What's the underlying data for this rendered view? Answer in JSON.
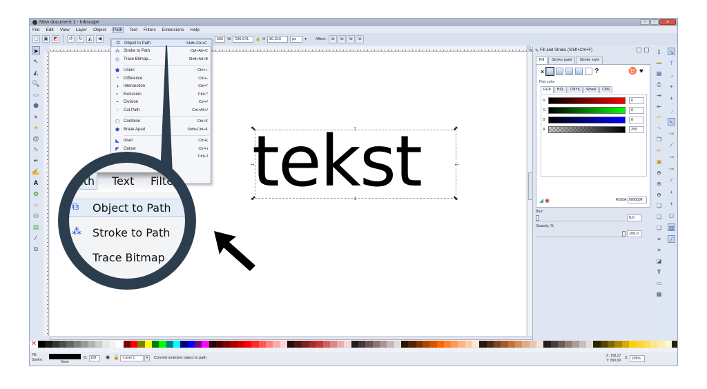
{
  "window": {
    "title": "New document 1 - Inkscape",
    "controls": {
      "minimize": "–",
      "maximize": "▫",
      "close": "x"
    }
  },
  "menubar": [
    "File",
    "Edit",
    "View",
    "Layer",
    "Object",
    "Path",
    "Text",
    "Filters",
    "Extensions",
    "Help"
  ],
  "menubar_active": "Path",
  "toolbar": {
    "x_value": "506",
    "w_label": "W",
    "w_value": "236,641",
    "h_label": "H",
    "h_value": "80,316",
    "unit": "px",
    "affect_label": "Affect:"
  },
  "path_menu": [
    {
      "icon": "object-to-path-icon",
      "label": "Object to Path",
      "shortcut": "Shift+Ctrl+C",
      "highlighted": true
    },
    {
      "icon": "stroke-to-path-icon",
      "label": "Stroke to Path",
      "shortcut": "Ctrl+Alt+C"
    },
    {
      "icon": "trace-bitmap-icon",
      "label": "Trace Bitmap...",
      "shortcut": "Shift+Alt+B"
    },
    {
      "separator": true
    },
    {
      "icon": "union-icon",
      "label": "Union",
      "shortcut": "Ctrl++"
    },
    {
      "icon": "difference-icon",
      "label": "Difference",
      "shortcut": "Ctrl+-"
    },
    {
      "icon": "intersection-icon",
      "label": "Intersection",
      "shortcut": "Ctrl+*"
    },
    {
      "icon": "exclusion-icon",
      "label": "Exclusion",
      "shortcut": "Ctrl+^"
    },
    {
      "icon": "division-icon",
      "label": "Division",
      "shortcut": "Ctrl+/"
    },
    {
      "icon": "cut-path-icon",
      "label": "Cut Path",
      "shortcut": "Ctrl+Alt+/"
    },
    {
      "separator": true
    },
    {
      "icon": "combine-icon",
      "label": "Combine",
      "shortcut": "Ctrl+K"
    },
    {
      "icon": "break-apart-icon",
      "label": "Break Apart",
      "shortcut": "Shift+Ctrl+K"
    },
    {
      "separator": true
    },
    {
      "icon": "inset-icon",
      "label": "Inset",
      "shortcut": "Ctrl+("
    },
    {
      "icon": "outset-icon",
      "label": "Outset",
      "shortcut": "Ctrl+)"
    },
    {
      "icon": "dynamic-offset-icon",
      "label": "",
      "shortcut": "Ctrl+J"
    }
  ],
  "magnifier": {
    "menus": [
      "Path",
      "Text",
      "Filte"
    ],
    "items": [
      "Object to Path",
      "Stroke to Path",
      "Trace Bitmap"
    ]
  },
  "canvas": {
    "text": "tekst"
  },
  "fill_stroke": {
    "title": "Fill and Stroke (Shift+Ctrl+F)",
    "tabs": [
      "Fill",
      "Stroke paint",
      "Stroke style"
    ],
    "paint_unknown": "?",
    "flat_color_label": "Flat color",
    "color_tabs": [
      "RGB",
      "HSL",
      "CMYK",
      "Wheel",
      "CMS"
    ],
    "channels": [
      {
        "key": "R",
        "value": "0",
        "color": "#ff0000"
      },
      {
        "key": "G",
        "value": "0",
        "color": "#00ff00"
      },
      {
        "key": "B",
        "value": "0",
        "color": "#0000ff"
      },
      {
        "key": "A",
        "value": "255",
        "color": "#000000"
      }
    ],
    "rgba_label": "RGBA:",
    "rgba_value": "000000ff",
    "blur_label": "Blur:",
    "blur_value": "0,0",
    "opacity_label": "Opacity, %",
    "opacity_value": "100,0"
  },
  "statusbar": {
    "fill_label": "Fill:",
    "stroke_label": "Stroke:",
    "stroke_value": "None",
    "fill_color": "#000000",
    "opacity_label": "O:",
    "opacity_value": "100",
    "layer": "-Layer 1",
    "message": "Convert selected object to path",
    "x_label": "X:",
    "x_value": "158,27",
    "y_label": "Y:",
    "y_value": "890,69",
    "zoom_label": "Z:",
    "zoom_value": "209%"
  },
  "palette": [
    "#000000",
    "#1a1a1a",
    "#333333",
    "#4d4d4d",
    "#666666",
    "#808080",
    "#999999",
    "#b3b3b3",
    "#cccccc",
    "#e6e6e6",
    "#f2f2f2",
    "#ffffff",
    "#800000",
    "#ff0000",
    "#808000",
    "#ffff00",
    "#008000",
    "#00ff00",
    "#008080",
    "#00ffff",
    "#000080",
    "#0000ff",
    "#800080",
    "#ff00ff",
    "#2b0000",
    "#550000",
    "#800000",
    "#aa0000",
    "#d40000",
    "#ff0000",
    "#ff2a2a",
    "#ff5555",
    "#ff8080",
    "#ffaaaa",
    "#ffd5d5",
    "#280b0b",
    "#501616",
    "#782121",
    "#a02c2c",
    "#c83737",
    "#d35f5f",
    "#de8787",
    "#e9afaf",
    "#f4d7d7",
    "#241c1c",
    "#483737",
    "#6c5353",
    "#916f6f",
    "#ac9393",
    "#c8b7b7",
    "#e3dbdb",
    "#2b1100",
    "#552200",
    "#803300",
    "#aa4400",
    "#d45500",
    "#ff6600",
    "#ff7f2a",
    "#ff9955",
    "#ffb380",
    "#ffccaa",
    "#ffe6d5",
    "#28170b",
    "#502d16",
    "#784421",
    "#a05a2c",
    "#c87137",
    "#d38d5f",
    "#deaa87",
    "#e9c6af",
    "#f4e3d7",
    "#241f1c",
    "#483e37",
    "#6c5d53",
    "#917c6f",
    "#ac9d93",
    "#c8beb7",
    "#e3dedb",
    "#2b2200",
    "#554400",
    "#806600",
    "#aa8800",
    "#d4aa00",
    "#ffcc00",
    "#ffd42a",
    "#ffdd55",
    "#ffe680",
    "#ffeeaa",
    "#fff6d5",
    "#28220b"
  ]
}
